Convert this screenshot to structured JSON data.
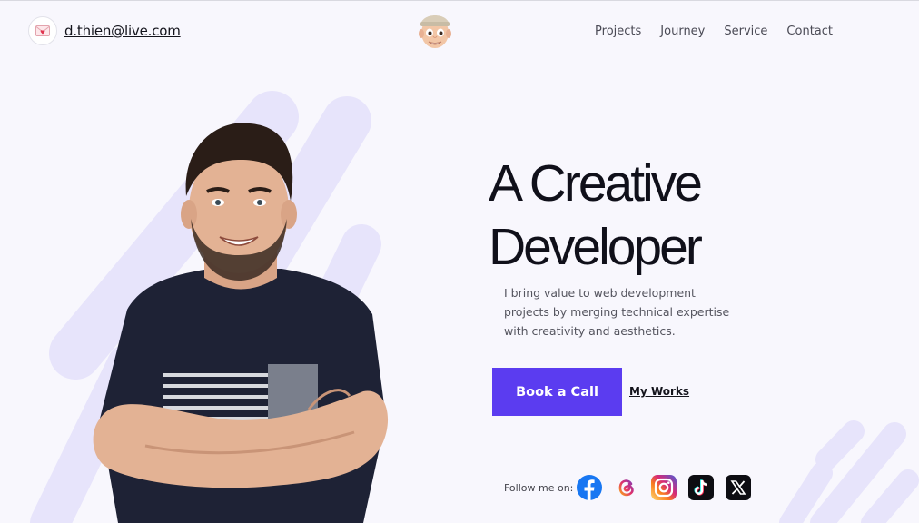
{
  "header": {
    "email": "d.thien@live.com",
    "nav": [
      "Projects",
      "Journey",
      "Service",
      "Contact"
    ]
  },
  "hero": {
    "headline_line1": "A Creative",
    "headline_line2": "Developer",
    "description": "I bring value to web development projects by merging technical expertise with creativity and aesthetics.",
    "book_button": "Book a Call",
    "works_link": "My Works"
  },
  "social": {
    "label": "Follow me on:",
    "icons": [
      "facebook-icon",
      "threads-icon",
      "instagram-icon",
      "tiktok-icon",
      "x-icon"
    ]
  },
  "colors": {
    "accent": "#5b3cf0",
    "background": "#f8f7fd",
    "stripe": "#e6e3fa"
  }
}
